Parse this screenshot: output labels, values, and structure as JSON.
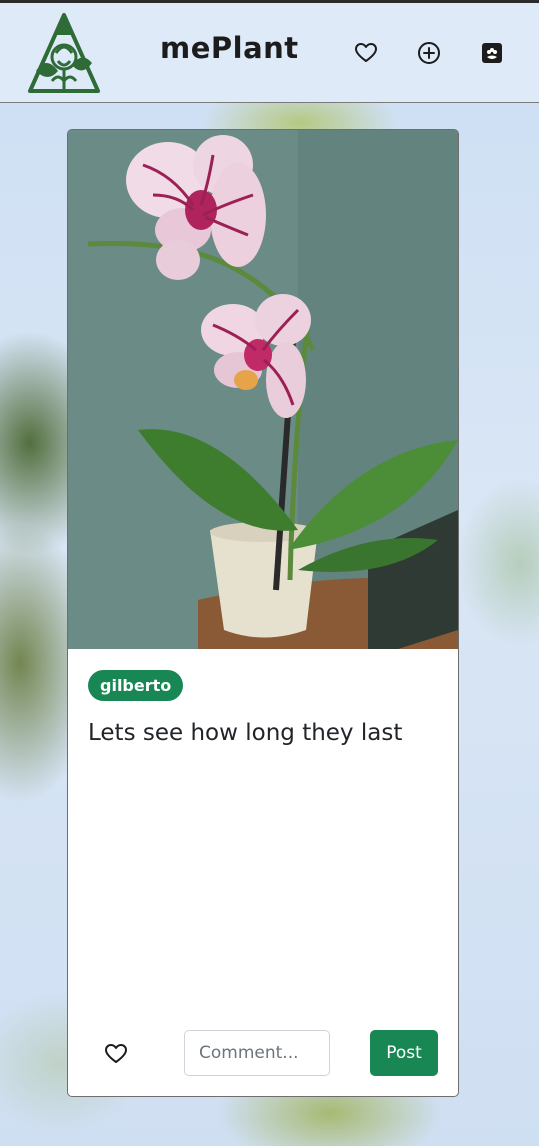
{
  "app": {
    "brand": "mePlant"
  },
  "navbar": {
    "logo_icon": "plant-logo-icon",
    "icons": [
      "heart-icon",
      "plus-circle-icon",
      "flower-box-icon"
    ]
  },
  "post": {
    "image_subject": "orchid-photo",
    "username": "gilberto",
    "caption": "Lets see how long they last",
    "like_icon": "heart-outline-icon",
    "comment_placeholder": "Comment...",
    "comment_value": "",
    "post_label": "Post"
  },
  "colors": {
    "accent_green": "#198754",
    "navbar_bg": "#dfeaf9",
    "logo_green": "#2e6b36"
  }
}
